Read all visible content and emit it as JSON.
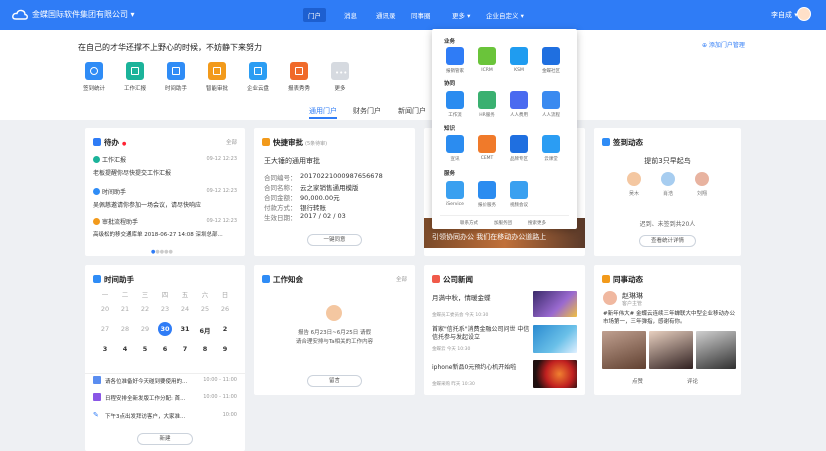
{
  "topbar": {
    "company": "金蝶国际软件集团有限公司 ▾",
    "nav": [
      "门户",
      "消息",
      "通讯录",
      "同事圈",
      "更多 ▾",
      "企业自定义 ▾"
    ],
    "user": "李自成 ▾"
  },
  "hero": {
    "slogan": "在自己的才华还撑不上野心的时候，不妨静下来努力",
    "settings": "⊕ 添加门户管理",
    "apps": [
      "签到统计",
      "工作汇报",
      "时间助手",
      "智能审批",
      "企业云盘",
      "报表秀秀",
      "更多"
    ],
    "portal_tabs": [
      "通用门户",
      "财务门户",
      "新闻门户"
    ]
  },
  "todo": {
    "title": "待办",
    "badge": "●",
    "all": "全部",
    "items": [
      {
        "tag": "工作汇报",
        "time": "09-12 12:23",
        "text": "老板提醒你尽快提交工作汇报"
      },
      {
        "tag": "时间助手",
        "time": "09-12 12:23",
        "text": "吴佩慈邀请你参加一场会议，请尽快响应"
      },
      {
        "tag": "审批流程助手",
        "time": "09-12 12:23",
        "text": "高级松的移交通库单 2018-06-27 14:08 深圳总部..."
      }
    ]
  },
  "approval": {
    "title": "快捷审批",
    "sub": "(5条待审)",
    "heading": "王大锤的通用审批",
    "fields": [
      {
        "k": "合同编号：",
        "v": "20170221000987656678"
      },
      {
        "k": "合同名称：",
        "v": "云之家销售通用模版"
      },
      {
        "k": "合同金额：",
        "v": "90,000.00元"
      },
      {
        "k": "付款方式：",
        "v": "银行转账"
      },
      {
        "k": "生效日期：",
        "v": "2017 / 02 / 03"
      }
    ],
    "btn": "一键同意"
  },
  "banner": {
    "caption": "引领协同办公  我们在移动办公道路上"
  },
  "signin": {
    "title": "签到动态",
    "msg": "提前3只早起鸟",
    "people": [
      "吴木",
      "肖浩",
      "刘翔"
    ],
    "stat": "迟到、未签到共20人",
    "btn": "查看统计详情"
  },
  "time": {
    "title": "时间助手",
    "weekdays": [
      "一",
      "二",
      "三",
      "四",
      "五",
      "六",
      "日"
    ],
    "rows": [
      [
        "20",
        "21",
        "22",
        "23",
        "24",
        "25",
        "26"
      ],
      [
        "27",
        "28",
        "29",
        "30",
        "31",
        "6月",
        "2"
      ],
      [
        "3",
        "4",
        "5",
        "6",
        "7",
        "8",
        "9"
      ]
    ],
    "events": [
      {
        "text": "请各位准备好今天碰到要使用的...",
        "time": "10:00 - 11:00"
      },
      {
        "text": "日程安排全新发版工作分配: 首...",
        "time": "10:00 - 11:00"
      },
      {
        "text": "下午3点出发拜访客户，大家准...",
        "time": "10:00"
      }
    ],
    "btn": "新建"
  },
  "notice": {
    "title": "工作知会",
    "all": "全部",
    "text1": "报告 6月23日~6月25日 请假",
    "text2": "请合理安排与Ta相关的工作内容",
    "btn": "留言"
  },
  "news": {
    "title": "公司新闻",
    "items": [
      {
        "title": "月满中秋，情暖金蝶",
        "meta": "金蝶员工委员会  今天 10:30"
      },
      {
        "title": "首家\"信托系\"消费金融公司问世 中信信托参与发起设立",
        "meta": "金蝶云  今天 10:30"
      },
      {
        "title": "iphone新品0元预约心机开始啦",
        "meta": "金蝶采购  昨天 10:30"
      }
    ]
  },
  "circle": {
    "title": "同事动态",
    "name": "赵琳琳",
    "role": "客户主管",
    "post": "#新年伟大# 金蝶云连续三年蝉联大中型企业移动办公市场第一，三年弹指，感谢有你。",
    "like": "点赞",
    "comment": "评论"
  },
  "menu": {
    "sections": [
      "业务",
      "协同",
      "知识",
      "服务"
    ],
    "items": [
      [
        "报销管家",
        "ICRM",
        "KSM",
        "金蝶社区"
      ],
      [
        "工作流",
        "HR服务",
        "人人费用",
        "人人流程"
      ],
      [
        "宣讯",
        "CEMT",
        "品牌专区",
        "云课堂"
      ],
      [
        "iService",
        "报价服务",
        "视频会议"
      ]
    ],
    "footer": [
      "联系方式",
      "加服务团",
      "搜索更多"
    ]
  },
  "colors": {
    "brand": "#2f7cf6"
  }
}
